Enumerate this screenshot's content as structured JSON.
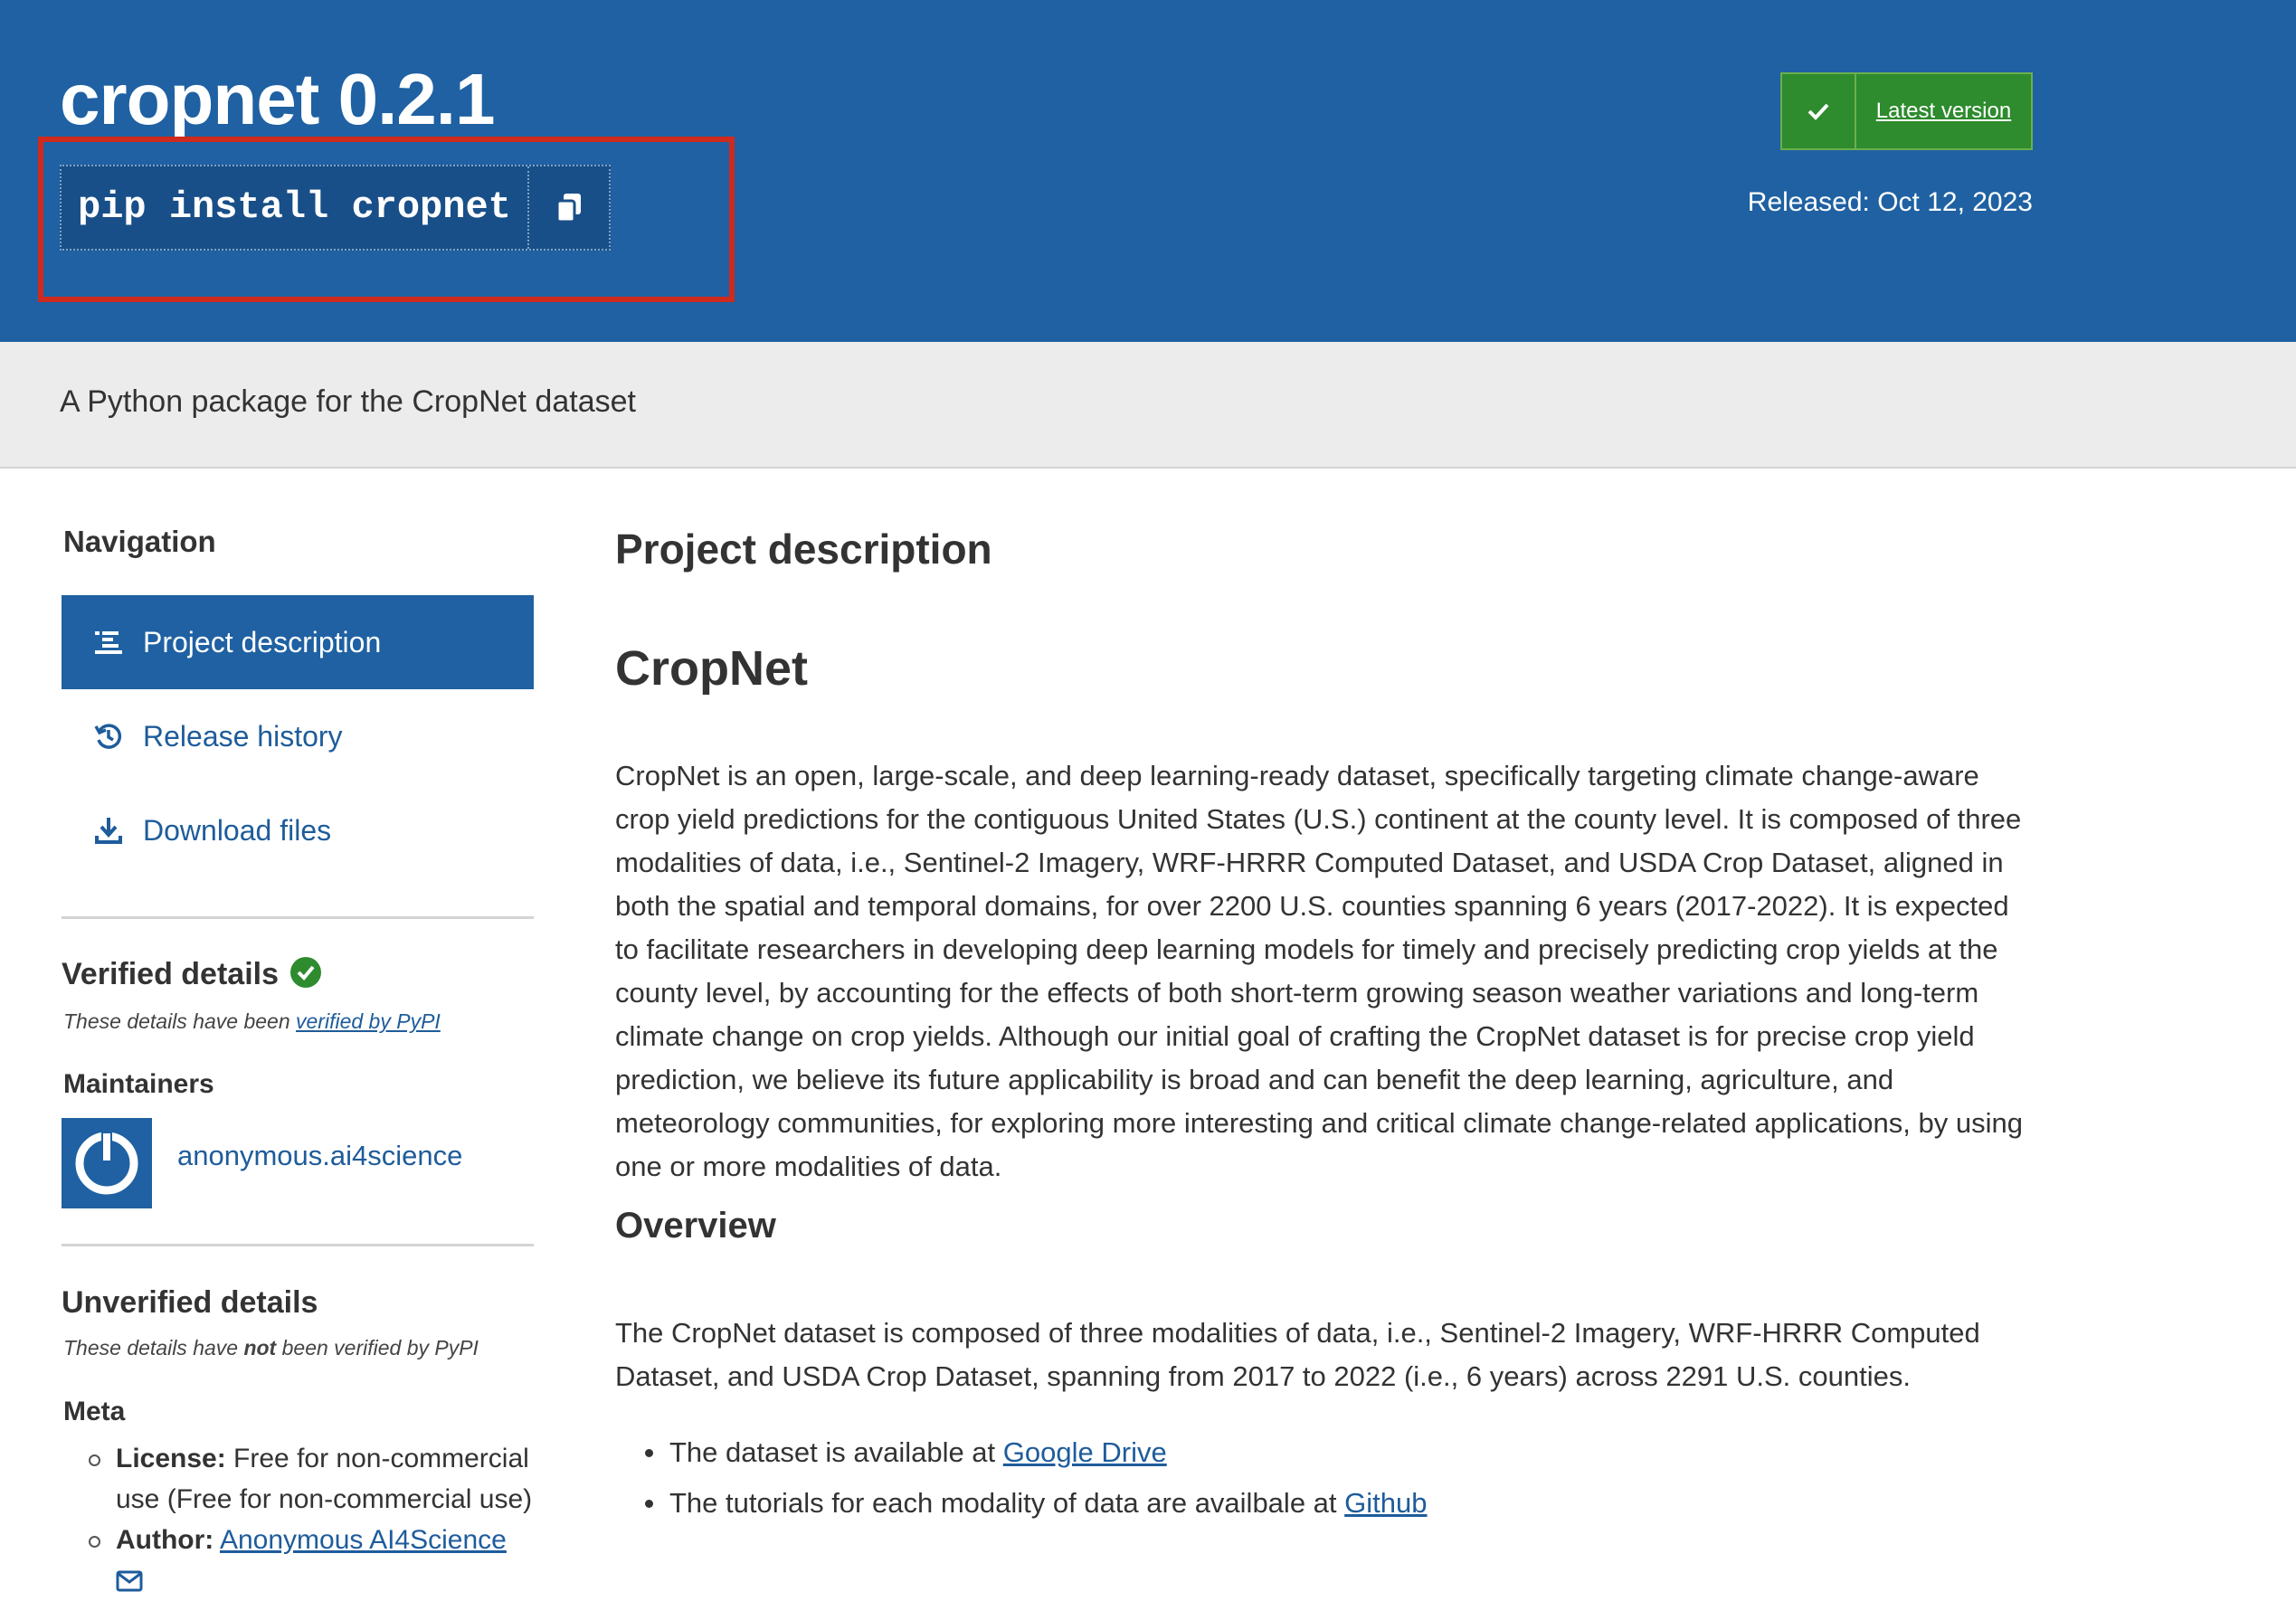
{
  "header": {
    "title": "cropnet 0.2.1",
    "pip_command": "pip install cropnet",
    "latest_version_label": "Latest version",
    "released": "Released: Oct 12, 2023"
  },
  "summary": "A Python package for the CropNet dataset",
  "sidebar": {
    "nav_heading": "Navigation",
    "nav_items": [
      {
        "label": "Project description",
        "icon": "align-left-icon",
        "active": true
      },
      {
        "label": "Release history",
        "icon": "history-icon",
        "active": false
      },
      {
        "label": "Download files",
        "icon": "download-icon",
        "active": false
      }
    ],
    "verified_heading": "Verified details",
    "verified_note_prefix": "These details have been ",
    "verified_note_link": "verified by PyPI",
    "maintainers_heading": "Maintainers",
    "maintainer_name": "anonymous.ai4science",
    "unverified_heading": "Unverified details",
    "unverified_note_prefix": "These details have ",
    "unverified_note_bold": "not",
    "unverified_note_suffix": " been verified by PyPI",
    "meta_heading": "Meta",
    "license_label": "License:",
    "license_value": " Free for non-commercial use (Free for non-commercial use)",
    "author_label": "Author:",
    "author_value": "Anonymous AI4Science"
  },
  "main": {
    "section_heading": "Project description",
    "title": "CropNet",
    "intro": "CropNet is an open, large-scale, and deep learning-ready dataset, specifically targeting climate change-aware crop yield predictions for the contiguous United States (U.S.) continent at the county level. It is composed of three modalities of data, i.e., Sentinel-2 Imagery, WRF-HRRR Computed Dataset, and USDA Crop Dataset, aligned in both the spatial and temporal domains, for over 2200 U.S. counties spanning 6 years (2017-2022). It is expected to facilitate researchers in developing deep learning models for timely and precisely predicting crop yields at the county level, by accounting for the effects of both short-term growing season weather variations and long-term climate change on crop yields. Although our initial goal of crafting the CropNet dataset is for precise crop yield prediction, we believe its future applicability is broad and can benefit the deep learning, agriculture, and meteorology communities, for exploring more interesting and critical climate change-related applications, by using one or more modalities of data.",
    "overview_heading": "Overview",
    "overview_text": "The CropNet dataset is composed of three modalities of data, i.e., Sentinel-2 Imagery, WRF-HRRR Computed Dataset, and USDA Crop Dataset, spanning from 2017 to 2022 (i.e., 6 years) across 2291 U.S. counties.",
    "bullet1_text": "The dataset is available at ",
    "bullet1_link": "Google Drive",
    "bullet2_text": "The tutorials for each modality of data are availbale at ",
    "bullet2_link": "Github"
  },
  "colors": {
    "header_blue": "#1f61a2",
    "link_blue": "#1e5c9b",
    "latest_green": "#2e8b2e",
    "highlight_red": "#cf2a1e",
    "summary_gray": "#ececec"
  }
}
